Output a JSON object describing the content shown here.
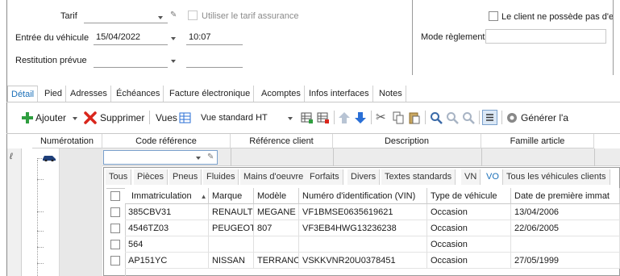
{
  "header": {
    "tarif_label": "Tarif",
    "tarif_value": "",
    "assurance_label": "Utiliser le tarif assurance",
    "entree_label": "Entrée du véhicule",
    "entree_date": "15/04/2022",
    "entree_time": "10:07",
    "restitution_label": "Restitution prévue",
    "client_checkbox_label": "Le client ne possède pas d'e",
    "mode_reglement_label": "Mode règlement"
  },
  "tabs": [
    "Détail",
    "Pied",
    "Adresses",
    "Échéances",
    "Facture électronique",
    "Acomptes",
    "Infos interfaces",
    "Notes"
  ],
  "toolbar": {
    "add_label": "Ajouter",
    "delete_label": "Supprimer",
    "views_label": "Vues",
    "view_value": "Vue standard HT",
    "generate_label": "Générer l'a"
  },
  "grid": {
    "columns": [
      "Numérotation",
      "Code référence",
      "Référence client",
      "Description",
      "Famille article"
    ]
  },
  "vehicle_tabs": [
    "Tous",
    "Pièces",
    "Pneus",
    "Fluides",
    "Mains d'oeuvre",
    "Forfaits",
    "Divers",
    "Textes standards",
    "VN",
    "VO",
    "Tous les véhicules clients"
  ],
  "vehicle_table": {
    "columns": [
      "Immatriculation",
      "Marque",
      "Modèle",
      "Numéro d'identification (VIN)",
      "Type de véhicule",
      "Date de première immat"
    ],
    "rows": [
      [
        "385CBV31",
        "RENAULT",
        "MEGANE",
        "VF1BMSE0635619621",
        "Occasion",
        "13/04/2006"
      ],
      [
        "4546TZ03",
        "PEUGEOT",
        "807",
        "VF3EB4HWG13236238",
        "Occasion",
        "22/06/2005"
      ],
      [
        "564",
        "",
        "",
        "",
        "Occasion",
        ""
      ],
      [
        "AP151YC",
        "NISSAN",
        "TERRANO",
        "VSKKVNR20U0378451",
        "Occasion",
        "27/05/1999"
      ]
    ]
  },
  "colors": {
    "accent": "#1a6fb8",
    "add_green": "#2f9e3f",
    "delete_red": "#d9261c",
    "arrow_blue": "#2a6fd6"
  }
}
